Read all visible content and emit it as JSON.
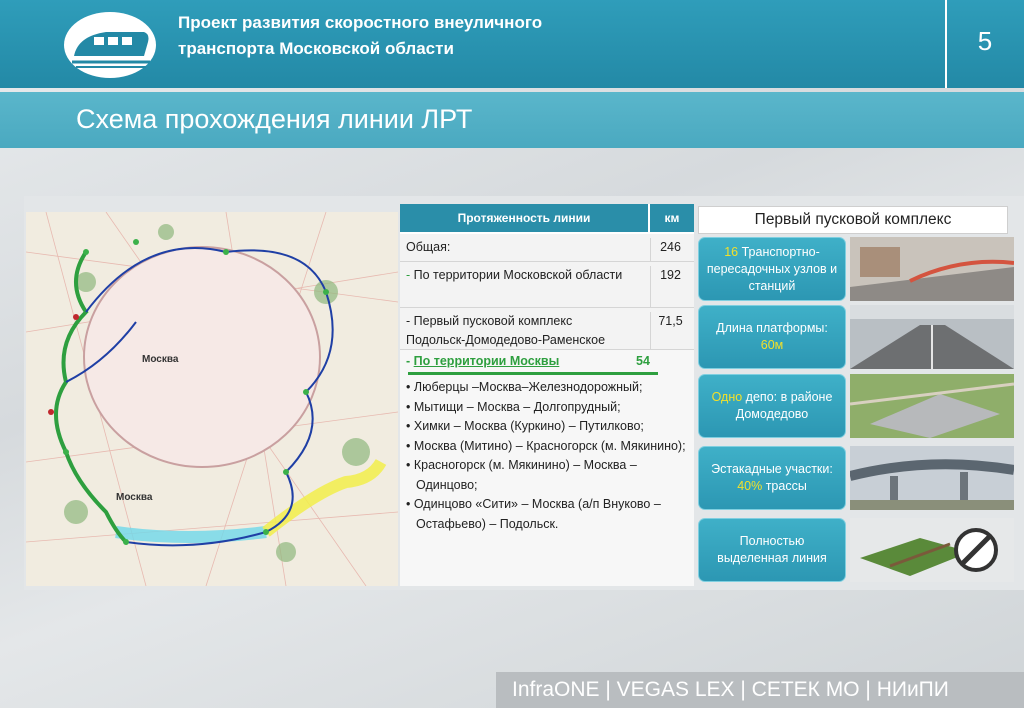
{
  "header": {
    "title_line1": "Проект развития скоростного внеуличного",
    "title_line2": "транспорта Московской области",
    "page_number": "5"
  },
  "slide": {
    "title": "Схема прохождения линии ЛРТ"
  },
  "map": {
    "labels": [
      "Москва",
      "Москва"
    ]
  },
  "length_table": {
    "col_line": "Протяженность линии",
    "col_km": "км",
    "rows": [
      {
        "label": "Общая:",
        "value": "246"
      },
      {
        "label": "По территории Московской области",
        "value": "192"
      },
      {
        "label_line1": "- Первый пусковой комплекс",
        "label_line2": "Подольск-Домодедово-Раменское",
        "value": "71,5"
      }
    ],
    "moscow": {
      "title": "По территории Москвы",
      "value": "54",
      "items": [
        "Люберцы –Москва–Железнодорожный;",
        "Мытищи – Москва – Долгопрудный;",
        "Химки – Москва (Куркино) – Путилково;",
        "Москва (Митино) – Красногорск (м. Мякинино);",
        "Красногорск (м. Мякинино) – Москва – Одинцово;",
        "Одинцово «Сити» – Москва (а/п Внуково – Остафьево) – Подольск."
      ]
    }
  },
  "first_complex": {
    "title": "Первый пусковой комплекс",
    "features": [
      {
        "highlight": "16",
        "text": " Транспортно-пересадочных узлов и станций"
      },
      {
        "text": "Длина платформы: ",
        "highlight": "60м"
      },
      {
        "highlight": "Одно",
        "text": " депо: в районе Домодедово"
      },
      {
        "text": "Эстакадные участки: ",
        "highlight": "40%",
        "text2": " трассы"
      },
      {
        "text": "Полностью выделенная линия"
      }
    ]
  },
  "footer": {
    "text": "InfraONE | VEGAS LEX | СЕТЕК МО | НИиПИ"
  },
  "colors": {
    "header": "#2389a6",
    "subheader": "#4aa9c0",
    "feature": "#2c97b3",
    "highlight": "#f2e02a",
    "green": "#2e9f3f"
  }
}
